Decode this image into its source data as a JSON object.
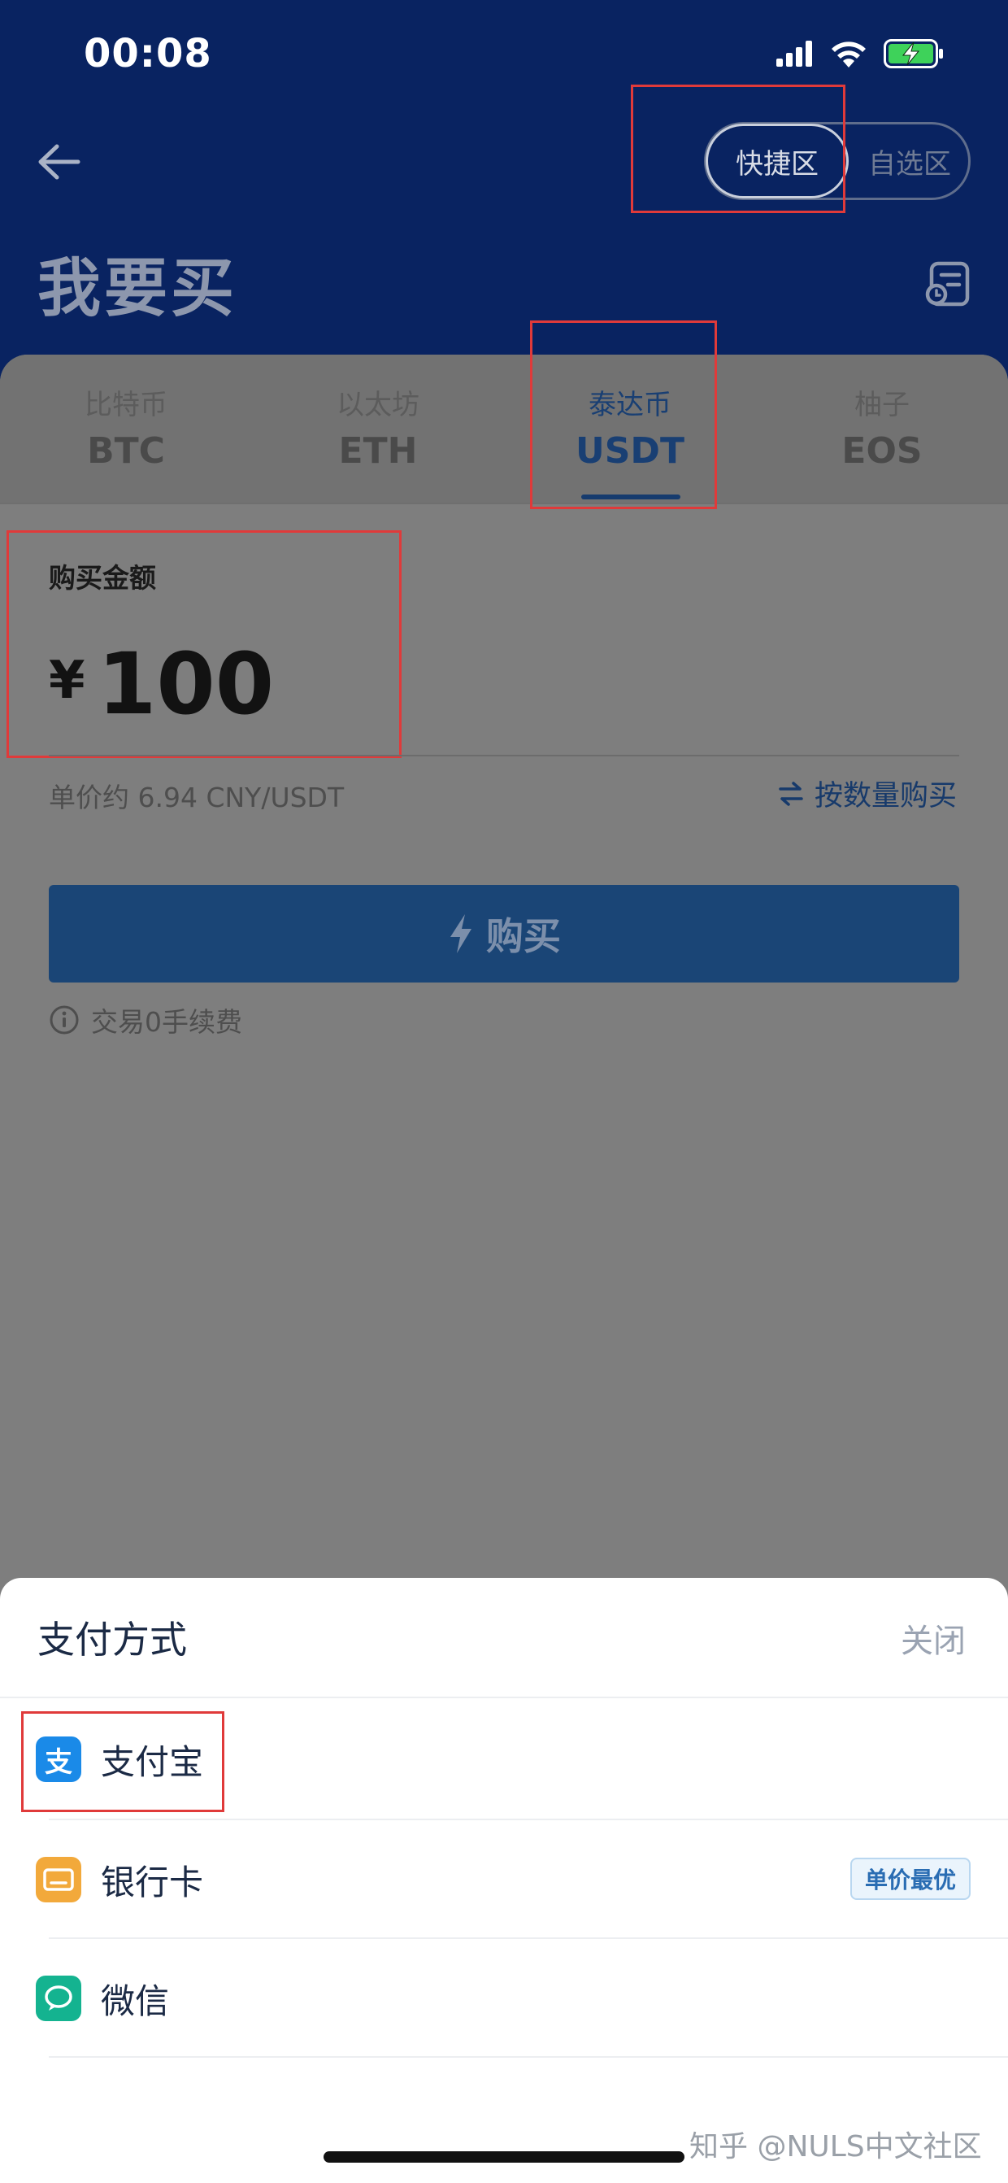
{
  "status_bar": {
    "time": "00:08"
  },
  "header": {
    "title": "我要买",
    "mode_toggle": {
      "active": "快捷区",
      "inactive": "自选区"
    }
  },
  "tabs": [
    {
      "cn": "比特币",
      "en": "BTC"
    },
    {
      "cn": "以太坊",
      "en": "ETH"
    },
    {
      "cn": "泰达币",
      "en": "USDT"
    },
    {
      "cn": "柚子",
      "en": "EOS"
    }
  ],
  "active_tab": "USDT",
  "purchase": {
    "amount_label": "购买金额",
    "currency_symbol": "¥",
    "amount": "100",
    "unit_price": "单价约 6.94 CNY/USDT",
    "buy_by_quantity": "按数量购买",
    "buy_button": "购买",
    "fee_note": "交易0手续费"
  },
  "payment_sheet": {
    "title": "支付方式",
    "close": "关闭",
    "options": [
      {
        "label": "支付宝",
        "icon": "alipay-icon",
        "icon_text": "支",
        "color": "#1a8ae8"
      },
      {
        "label": "银行卡",
        "icon": "bank-card-icon",
        "badge": "单价最优",
        "color": "#f2a93b"
      },
      {
        "label": "微信",
        "icon": "wechat-icon",
        "color": "#14b390"
      }
    ]
  },
  "watermark": "知乎 @NULS中文社区"
}
